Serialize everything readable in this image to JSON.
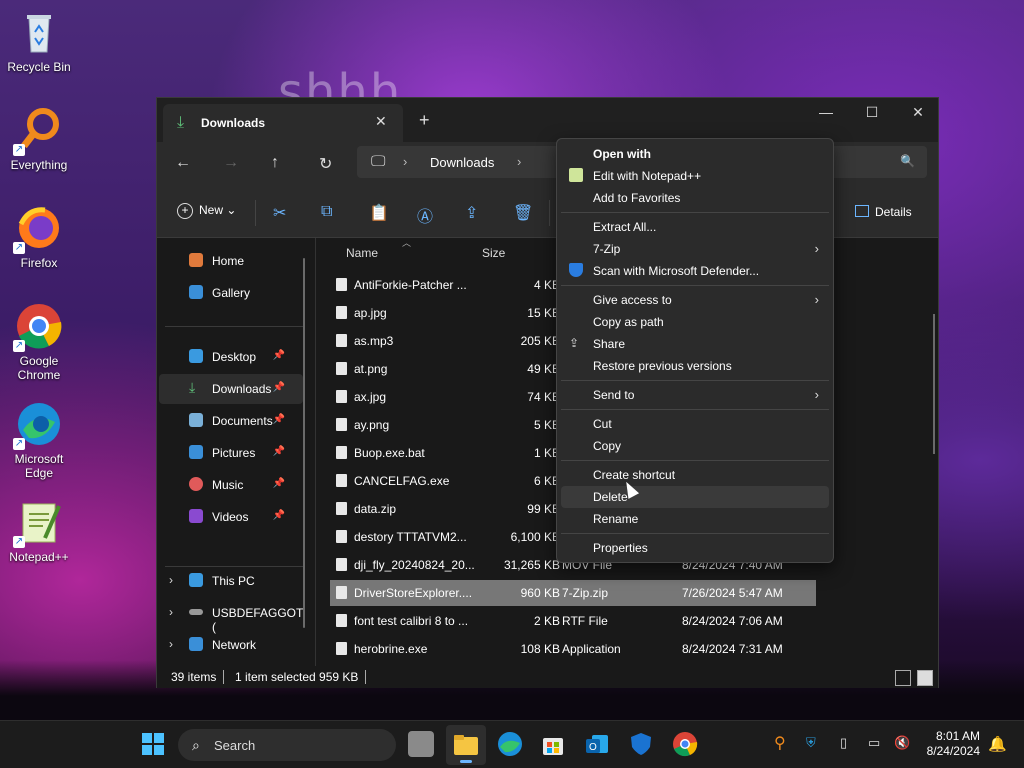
{
  "desktop": {
    "wallpaper_text": "shhh",
    "icons": [
      {
        "label": "Recycle Bin",
        "icon": "recycle-bin-icon"
      },
      {
        "label": "Everything",
        "icon": "everything-search-icon"
      },
      {
        "label": "Firefox",
        "icon": "firefox-icon"
      },
      {
        "label": "Google Chrome",
        "icon": "chrome-icon"
      },
      {
        "label": "Microsoft Edge",
        "icon": "edge-icon"
      },
      {
        "label": "Notepad++",
        "icon": "notepadpp-icon"
      }
    ]
  },
  "explorer": {
    "tab_title": "Downloads",
    "address": {
      "crumb": "Downloads"
    },
    "toolbar": {
      "new_label": "New",
      "details_label": "Details"
    },
    "sidebar": {
      "items": [
        {
          "label": "Home"
        },
        {
          "label": "Gallery"
        },
        {
          "label": "Desktop"
        },
        {
          "label": "Downloads"
        },
        {
          "label": "Documents"
        },
        {
          "label": "Pictures"
        },
        {
          "label": "Music"
        },
        {
          "label": "Videos"
        },
        {
          "label": "This PC"
        },
        {
          "label": "USBDEFAGGOT ("
        },
        {
          "label": "Network"
        }
      ]
    },
    "columns": {
      "name": "Name",
      "size": "Size"
    },
    "files": [
      {
        "name": "AntiForkie-Patcher ...",
        "size": "4 KB",
        "type": "",
        "date": ""
      },
      {
        "name": "ap.jpg",
        "size": "15 KB",
        "type": "",
        "date": ""
      },
      {
        "name": "as.mp3",
        "size": "205 KB",
        "type": "",
        "date": ""
      },
      {
        "name": "at.png",
        "size": "49 KB",
        "type": "",
        "date": ""
      },
      {
        "name": "ax.jpg",
        "size": "74 KB",
        "type": "",
        "date": ""
      },
      {
        "name": "ay.png",
        "size": "5 KB",
        "type": "",
        "date": ""
      },
      {
        "name": "Buop.exe.bat",
        "size": "1 KB",
        "type": "",
        "date": ""
      },
      {
        "name": "CANCELFAG.exe",
        "size": "6 KB",
        "type": "",
        "date": ""
      },
      {
        "name": "data.zip",
        "size": "99 KB",
        "type": "",
        "date": ""
      },
      {
        "name": "destory TTTATVM2...",
        "size": "6,100 KB",
        "type": "",
        "date": ""
      },
      {
        "name": "dji_fly_20240824_20...",
        "size": "31,265 KB",
        "type": "MOV File",
        "date": "8/24/2024 7:40 AM"
      },
      {
        "name": "DriverStoreExplorer....",
        "size": "960 KB",
        "type": "7-Zip.zip",
        "date": "7/26/2024 5:47 AM"
      },
      {
        "name": "font test calibri 8 to ...",
        "size": "2 KB",
        "type": "RTF File",
        "date": "8/24/2024 7:06 AM"
      },
      {
        "name": "herobrine.exe",
        "size": "108 KB",
        "type": "Application",
        "date": "8/24/2024 7:31 AM"
      }
    ],
    "status": {
      "items": "39 items",
      "selected": "1 item selected  959 KB"
    }
  },
  "context_menu": {
    "items": [
      {
        "label": "Open with"
      },
      {
        "label": "Edit with Notepad++"
      },
      {
        "label": "Add to Favorites"
      },
      {
        "label": "Extract All..."
      },
      {
        "label": "7-Zip"
      },
      {
        "label": "Scan with Microsoft Defender..."
      },
      {
        "label": "Give access to"
      },
      {
        "label": "Copy as path"
      },
      {
        "label": "Share"
      },
      {
        "label": "Restore previous versions"
      },
      {
        "label": "Send to"
      },
      {
        "label": "Cut"
      },
      {
        "label": "Copy"
      },
      {
        "label": "Create shortcut"
      },
      {
        "label": "Delete"
      },
      {
        "label": "Rename"
      },
      {
        "label": "Properties"
      }
    ]
  },
  "taskbar": {
    "search_label": "Search",
    "time": "8:01 AM",
    "date": "8/24/2024"
  },
  "colors": {
    "accent": "#6cb6ff",
    "selection": "#777777"
  }
}
